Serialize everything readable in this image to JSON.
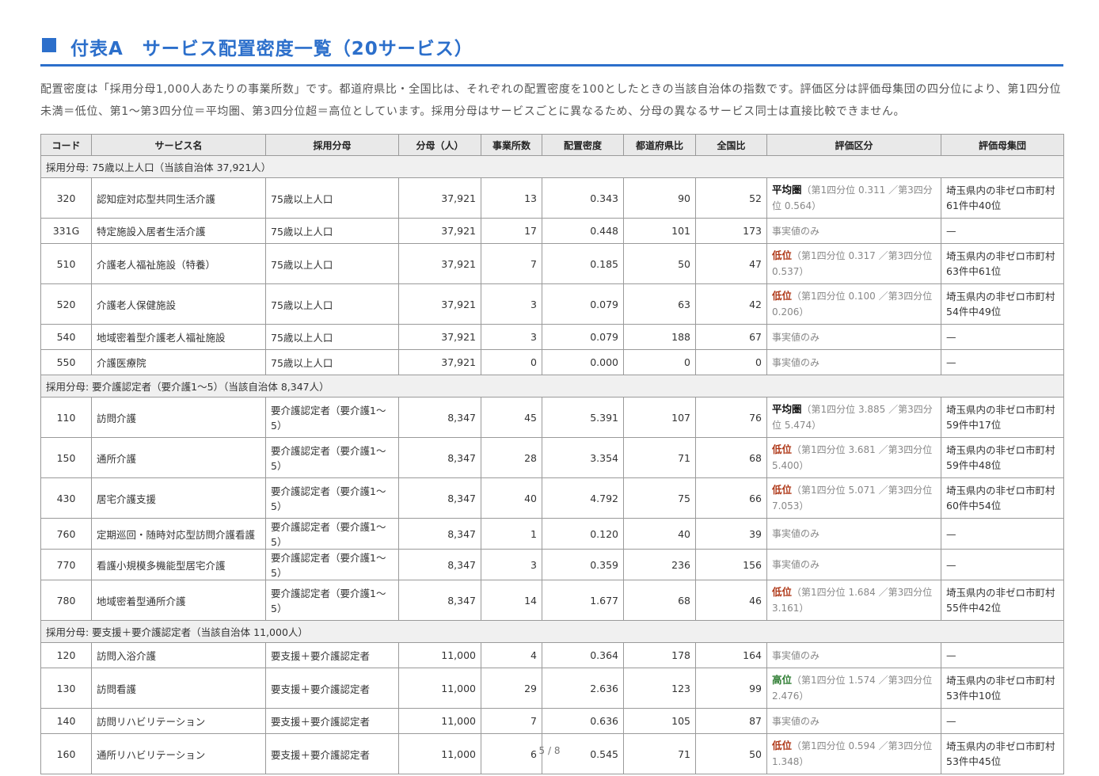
{
  "title": "付表A　サービス配置密度一覧（20サービス）",
  "description": "配置密度は「採用分母1,000人あたりの事業所数」です。都道府県比・全国比は、それぞれの配置密度を100としたときの当該自治体の指数です。評価区分は評価母集団の四分位により、第1四分位未満＝低位、第1～第3四分位＝平均圏、第3四分位超＝高位としています。採用分母はサービスごとに異なるため、分母の異なるサービス同士は直接比較できません。",
  "headers": [
    "コード",
    "サービス名",
    "採用分母",
    "分母（人）",
    "事業所数",
    "配置密度",
    "都道府県比",
    "全国比",
    "評価区分",
    "評価母集団"
  ],
  "groups": [
    {
      "label": "採用分母: 75歳以上人口（当該自治体 37,921人）",
      "rows": [
        {
          "code": "320",
          "name": "認知症対応型共同生活介護",
          "basis": "75歳以上人口",
          "denom": "37,921",
          "count": "13",
          "density": "0.343",
          "pref": "90",
          "nat": "52",
          "eval": "平均圏",
          "level": "mid",
          "note": "（第1四分位 0.311 ／第3四分位 0.564）",
          "pop1": "埼玉県内の非ゼロ市町村",
          "pop2": "61件中40位"
        },
        {
          "code": "331G",
          "name": "特定施設入居者生活介護",
          "basis": "75歳以上人口",
          "denom": "37,921",
          "count": "17",
          "density": "0.448",
          "pref": "101",
          "nat": "173",
          "eval": "事実値のみ",
          "level": "none",
          "note": "",
          "pop1": "—",
          "pop2": ""
        },
        {
          "code": "510",
          "name": "介護老人福祉施設（特養）",
          "basis": "75歳以上人口",
          "denom": "37,921",
          "count": "7",
          "density": "0.185",
          "pref": "50",
          "nat": "47",
          "eval": "低位",
          "level": "low",
          "note": "（第1四分位 0.317 ／第3四分位 0.537）",
          "pop1": "埼玉県内の非ゼロ市町村",
          "pop2": "63件中61位"
        },
        {
          "code": "520",
          "name": "介護老人保健施設",
          "basis": "75歳以上人口",
          "denom": "37,921",
          "count": "3",
          "density": "0.079",
          "pref": "63",
          "nat": "42",
          "eval": "低位",
          "level": "low",
          "note": "（第1四分位 0.100 ／第3四分位 0.206）",
          "pop1": "埼玉県内の非ゼロ市町村",
          "pop2": "54件中49位"
        },
        {
          "code": "540",
          "name": "地域密着型介護老人福祉施設",
          "basis": "75歳以上人口",
          "denom": "37,921",
          "count": "3",
          "density": "0.079",
          "pref": "188",
          "nat": "67",
          "eval": "事実値のみ",
          "level": "none",
          "note": "",
          "pop1": "—",
          "pop2": ""
        },
        {
          "code": "550",
          "name": "介護医療院",
          "basis": "75歳以上人口",
          "denom": "37,921",
          "count": "0",
          "density": "0.000",
          "pref": "0",
          "nat": "0",
          "eval": "事実値のみ",
          "level": "none",
          "note": "",
          "pop1": "—",
          "pop2": ""
        }
      ]
    },
    {
      "label": "採用分母: 要介護認定者（要介護1～5）（当該自治体 8,347人）",
      "rows": [
        {
          "code": "110",
          "name": "訪問介護",
          "basis": "要介護認定者（要介護1～5）",
          "denom": "8,347",
          "count": "45",
          "density": "5.391",
          "pref": "107",
          "nat": "76",
          "eval": "平均圏",
          "level": "mid",
          "note": "（第1四分位 3.885 ／第3四分位 5.474）",
          "pop1": "埼玉県内の非ゼロ市町村",
          "pop2": "59件中17位"
        },
        {
          "code": "150",
          "name": "通所介護",
          "basis": "要介護認定者（要介護1～5）",
          "denom": "8,347",
          "count": "28",
          "density": "3.354",
          "pref": "71",
          "nat": "68",
          "eval": "低位",
          "level": "low",
          "note": "（第1四分位 3.681 ／第3四分位 5.400）",
          "pop1": "埼玉県内の非ゼロ市町村",
          "pop2": "59件中48位"
        },
        {
          "code": "430",
          "name": "居宅介護支援",
          "basis": "要介護認定者（要介護1～5）",
          "denom": "8,347",
          "count": "40",
          "density": "4.792",
          "pref": "75",
          "nat": "66",
          "eval": "低位",
          "level": "low",
          "note": "（第1四分位 5.071 ／第3四分位 7.053）",
          "pop1": "埼玉県内の非ゼロ市町村",
          "pop2": "60件中54位"
        },
        {
          "code": "760",
          "name": "定期巡回・随時対応型訪問介護看護",
          "basis": "要介護認定者（要介護1～5）",
          "denom": "8,347",
          "count": "1",
          "density": "0.120",
          "pref": "40",
          "nat": "39",
          "eval": "事実値のみ",
          "level": "none",
          "note": "",
          "pop1": "—",
          "pop2": ""
        },
        {
          "code": "770",
          "name": "看護小規模多機能型居宅介護",
          "basis": "要介護認定者（要介護1～5）",
          "denom": "8,347",
          "count": "3",
          "density": "0.359",
          "pref": "236",
          "nat": "156",
          "eval": "事実値のみ",
          "level": "none",
          "note": "",
          "pop1": "—",
          "pop2": ""
        },
        {
          "code": "780",
          "name": "地域密着型通所介護",
          "basis": "要介護認定者（要介護1～5）",
          "denom": "8,347",
          "count": "14",
          "density": "1.677",
          "pref": "68",
          "nat": "46",
          "eval": "低位",
          "level": "low",
          "note": "（第1四分位 1.684 ／第3四分位 3.161）",
          "pop1": "埼玉県内の非ゼロ市町村",
          "pop2": "55件中42位"
        }
      ]
    },
    {
      "label": "採用分母: 要支援＋要介護認定者（当該自治体 11,000人）",
      "rows": [
        {
          "code": "120",
          "name": "訪問入浴介護",
          "basis": "要支援＋要介護認定者",
          "denom": "11,000",
          "count": "4",
          "density": "0.364",
          "pref": "178",
          "nat": "164",
          "eval": "事実値のみ",
          "level": "none",
          "note": "",
          "pop1": "—",
          "pop2": ""
        },
        {
          "code": "130",
          "name": "訪問看護",
          "basis": "要支援＋要介護認定者",
          "denom": "11,000",
          "count": "29",
          "density": "2.636",
          "pref": "123",
          "nat": "99",
          "eval": "高位",
          "level": "high",
          "note": "（第1四分位 1.574 ／第3四分位 2.476）",
          "pop1": "埼玉県内の非ゼロ市町村",
          "pop2": "53件中10位"
        },
        {
          "code": "140",
          "name": "訪問リハビリテーション",
          "basis": "要支援＋要介護認定者",
          "denom": "11,000",
          "count": "7",
          "density": "0.636",
          "pref": "105",
          "nat": "87",
          "eval": "事実値のみ",
          "level": "none",
          "note": "",
          "pop1": "—",
          "pop2": ""
        },
        {
          "code": "160",
          "name": "通所リハビリテーション",
          "basis": "要支援＋要介護認定者",
          "denom": "11,000",
          "count": "6",
          "density": "0.545",
          "pref": "71",
          "nat": "50",
          "eval": "低位",
          "level": "low",
          "note": "（第1四分位 0.594 ／第3四分位 1.348）",
          "pop1": "埼玉県内の非ゼロ市町村",
          "pop2": "53件中45位"
        }
      ]
    }
  ],
  "footer": "5 / 8",
  "colors": {
    "accent": "#2c6fcb",
    "low": "#b03a1a",
    "high": "#2e7d32",
    "header_bg": "#e9e9e9"
  }
}
